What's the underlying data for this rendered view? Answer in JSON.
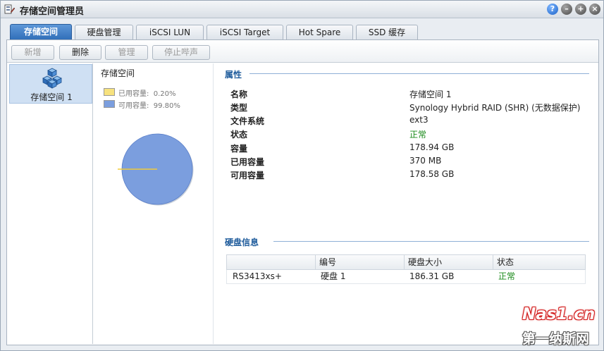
{
  "window": {
    "title": "存储空间管理员",
    "controls": {
      "help": "?",
      "minimize": "–",
      "maximize": "+",
      "close": "×"
    }
  },
  "tabs": [
    {
      "label": "存储空间",
      "active": true
    },
    {
      "label": "硬盘管理",
      "active": false
    },
    {
      "label": "iSCSI LUN",
      "active": false
    },
    {
      "label": "iSCSI Target",
      "active": false
    },
    {
      "label": "Hot Spare",
      "active": false
    },
    {
      "label": "SSD 缓存",
      "active": false
    }
  ],
  "toolbar": {
    "create_label": "新增",
    "delete_label": "删除",
    "manage_label": "管理",
    "stop_beep_label": "停止哔声"
  },
  "volumes": [
    {
      "label": "存储空间 1",
      "selected": true
    }
  ],
  "usage_chart": {
    "title": "存储空间",
    "legend": [
      {
        "label": "已用容量:",
        "value": "0.20%",
        "color": "#f7e27e"
      },
      {
        "label": "可用容量:",
        "value": "99.80%",
        "color": "#7b9ede"
      }
    ]
  },
  "chart_data": {
    "type": "pie",
    "title": "存储空间",
    "categories": [
      "已用容量",
      "可用容量"
    ],
    "values": [
      0.2,
      99.8
    ],
    "colors": [
      "#f2cc3a",
      "#7b9ede"
    ]
  },
  "properties": {
    "heading": "属性",
    "rows": [
      {
        "label": "名称",
        "value": "存储空间 1",
        "status": false
      },
      {
        "label": "类型",
        "value": "Synology Hybrid RAID (SHR) (无数据保护)",
        "status": false
      },
      {
        "label": "文件系统",
        "value": "ext3",
        "status": false
      },
      {
        "label": "状态",
        "value": "正常",
        "status": true
      },
      {
        "label": "容量",
        "value": "178.94 GB",
        "status": false
      },
      {
        "label": "已用容量",
        "value": "370 MB",
        "status": false
      },
      {
        "label": "可用容量",
        "value": "178.58 GB",
        "status": false
      }
    ]
  },
  "disk_info": {
    "heading": "硬盘信息",
    "columns": [
      "",
      "编号",
      "硬盘大小",
      "状态"
    ],
    "rows": [
      {
        "model": "RS3413xs+",
        "id": "硬盘 1",
        "size": "186.31 GB",
        "status": "正常"
      }
    ]
  },
  "watermark": {
    "line1": "Nas1.cn",
    "line2": "第一纳斯网"
  }
}
